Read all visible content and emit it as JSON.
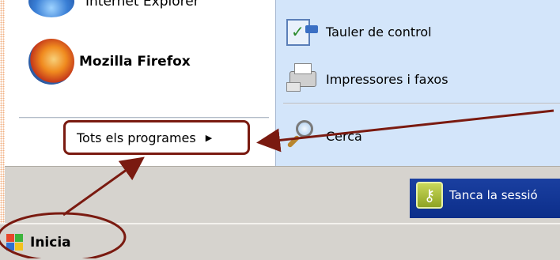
{
  "left_pane": {
    "internet_explorer_label": "Internet Explorer",
    "firefox_label": "Mozilla Firefox",
    "all_programs_label": "Tots els programes",
    "all_programs_arrow": "▶"
  },
  "right_pane": {
    "control_panel_label": "Tauler de control",
    "printers_label": "Impressores i faxos",
    "search_label": "Cerca"
  },
  "footer": {
    "logoff_label": "Tanca la sessió"
  },
  "taskbar": {
    "start_label": "Inicia"
  },
  "annotations": {
    "color": "#7a1a10"
  },
  "icons": [
    "internet-explorer-icon",
    "firefox-icon",
    "control-panel-icon",
    "printer-icon",
    "search-icon",
    "key-icon",
    "windows-logo-icon"
  ]
}
